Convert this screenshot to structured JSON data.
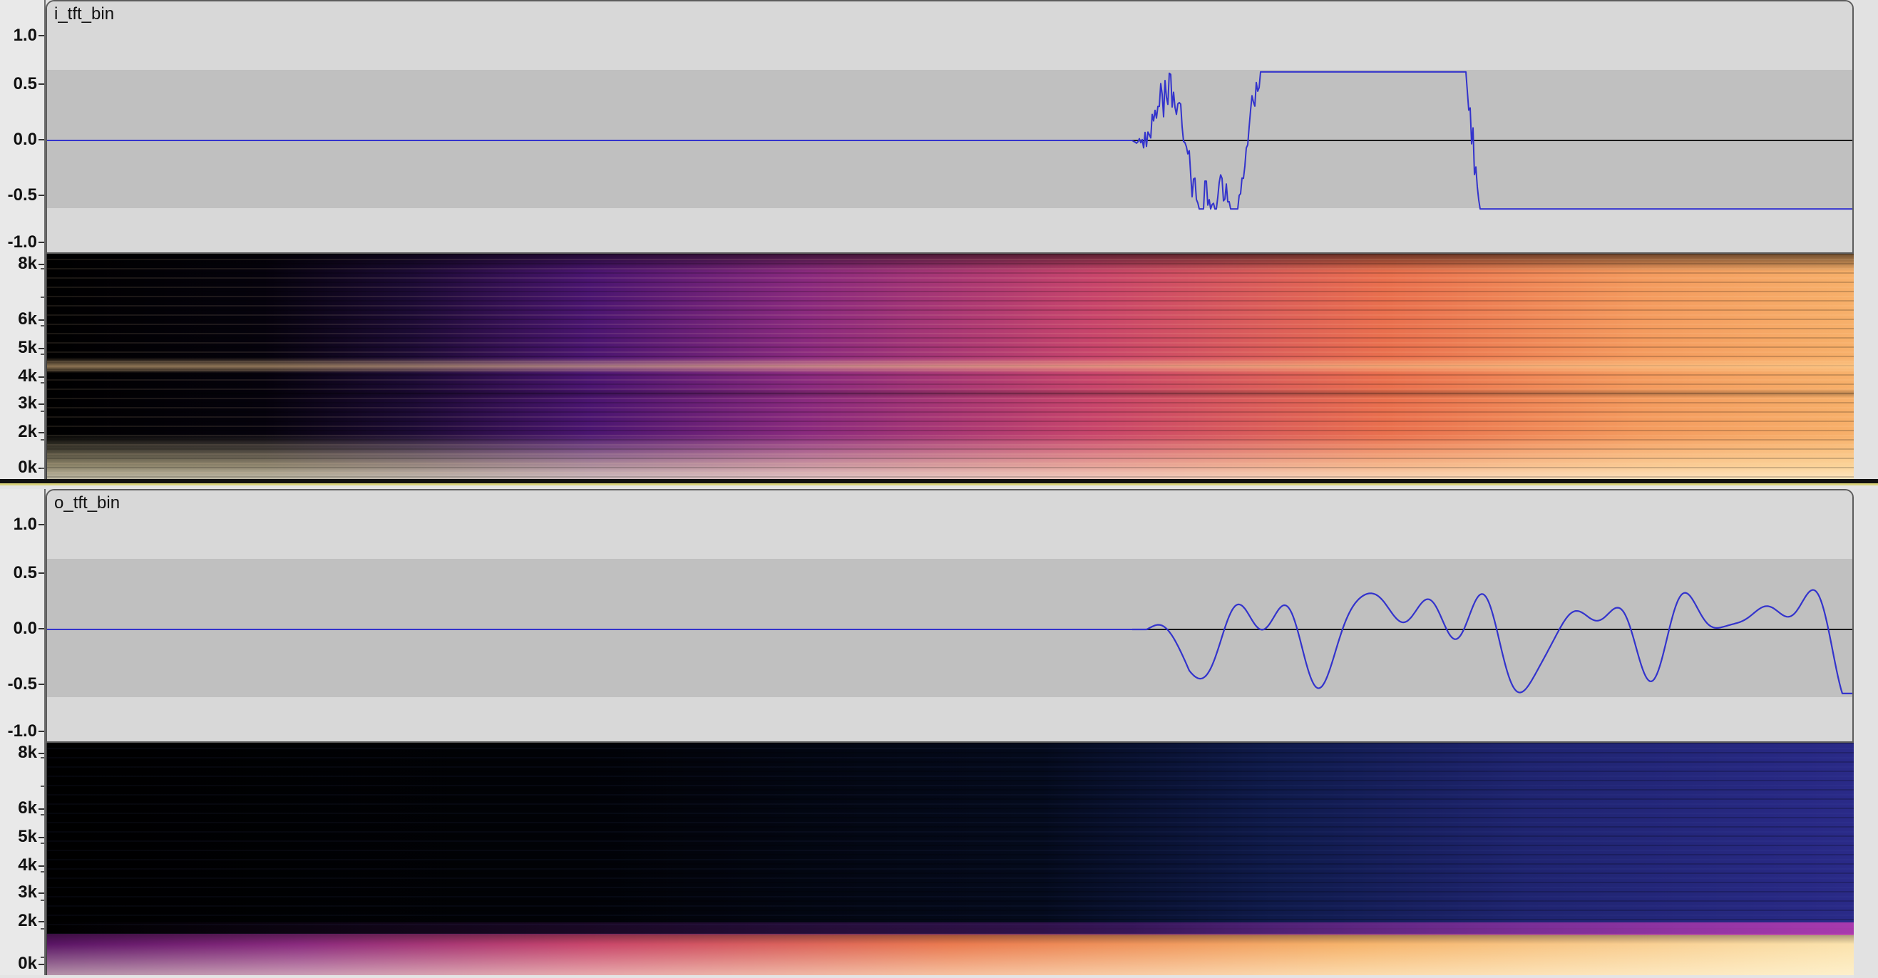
{
  "tracks": [
    {
      "name": "i_tft_bin",
      "amplitude_ticks": [
        "1.0",
        "0.5",
        "0.0",
        "-0.5",
        "-1.0"
      ],
      "frequency_ticks": [
        "8k",
        "6k",
        "5k",
        "4k",
        "3k",
        "2k",
        "0k"
      ],
      "waveform_color": "#3333cc",
      "waveform_character": "noisy",
      "silent_until_fraction": 0.6,
      "spectrogram_palette": "magma",
      "spectrogram_energy": "broadband"
    },
    {
      "name": "o_tft_bin",
      "amplitude_ticks": [
        "1.0",
        "0.5",
        "0.0",
        "-0.5",
        "-1.0"
      ],
      "frequency_ticks": [
        "8k",
        "6k",
        "5k",
        "4k",
        "3k",
        "2k",
        "0k"
      ],
      "waveform_color": "#3333cc",
      "waveform_character": "smooth",
      "silent_until_fraction": 0.6,
      "spectrogram_palette": "magma",
      "spectrogram_energy": "low-frequency"
    }
  ],
  "colors": {
    "background_light": "#d8d8d8",
    "background_band": "#c0c0c0",
    "waveform": "#3333cc",
    "separator_accent": "#d9d27a"
  }
}
